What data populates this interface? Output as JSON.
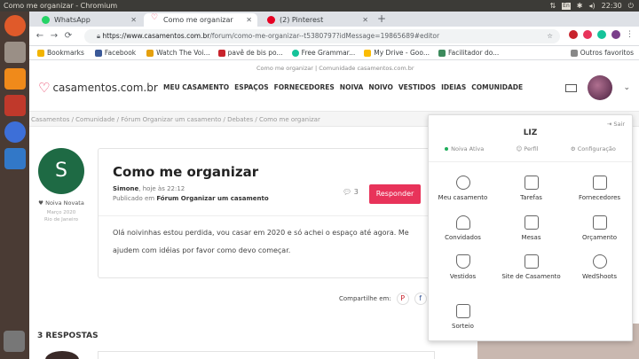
{
  "system": {
    "title": "Como me organizar - Chromium",
    "keyboard": "En",
    "time": "22:30"
  },
  "tabs": [
    {
      "label": "WhatsApp",
      "color": "#25d366"
    },
    {
      "label": "Como me organizar",
      "color": "#e8335a"
    },
    {
      "label": "(2) Pinterest",
      "color": "#e60023"
    }
  ],
  "newtab": "+",
  "url": {
    "host": "https://www.casamentos.com.br",
    "path": "/forum/como-me-organizar--t5380797?idMessage=19865689#editor"
  },
  "bookmarks": [
    {
      "label": "Bookmarks",
      "color": "#f2b400"
    },
    {
      "label": "Facebook",
      "color": "#3b5998"
    },
    {
      "label": "Watch The Voi...",
      "color": "#e5a00d"
    },
    {
      "label": "pavê de bis po...",
      "color": "#c8232c"
    },
    {
      "label": "Free Grammar...",
      "color": "#15c39a"
    },
    {
      "label": "My Drive - Goo...",
      "color": "#fbbc04"
    },
    {
      "label": "Facilitador do...",
      "color": "#3c8a5c"
    }
  ],
  "bookmarks_other": "Outros favoritos",
  "site": {
    "topline": "Como me organizar | Comunidade casamentos.com.br",
    "logo": "casamentos.com.br",
    "nav": [
      "MEU CASAMENTO",
      "ESPAÇOS",
      "FORNECEDORES",
      "NOIVA",
      "NOIVO",
      "VESTIDOS",
      "IDEIAS",
      "COMUNIDADE"
    ],
    "breadcrumb": "Casamentos   /   Comunidade   /   Fórum Organizar um casamento   /   Debates   /   Como me organizar"
  },
  "user": {
    "initial": "S",
    "badge": "Noiva Novata",
    "meta1": "Março 2020",
    "meta2": "Rio de Janeiro"
  },
  "post": {
    "title": "Como me organizar",
    "author": "Simone",
    "time": ", hoje às 22:12",
    "forum_prefix": "Publicado em ",
    "forum": "Fórum Organizar um casamento",
    "count": "3",
    "reply": "Responder",
    "body": "Olá noivinhas estou perdida, vou casar em 2020 e só achei o espaço até agora. Me ajudem com idéias por favor como devo começar."
  },
  "share": {
    "label": "Compartilhe em:"
  },
  "responses": "3 RESPOSTAS",
  "menu": {
    "logout": "Sair",
    "name": "LIZ",
    "links": [
      "Noiva Ativa",
      "Perfil",
      "Configuração"
    ],
    "items": [
      {
        "label": "Meu casamento"
      },
      {
        "label": "Tarefas"
      },
      {
        "label": "Fornecedores"
      },
      {
        "label": "Convidados"
      },
      {
        "label": "Mesas"
      },
      {
        "label": "Orçamento"
      },
      {
        "label": "Vestidos"
      },
      {
        "label": "Site de Casamento"
      },
      {
        "label": "WedShoots"
      },
      {
        "label": "Sorteio"
      }
    ]
  }
}
